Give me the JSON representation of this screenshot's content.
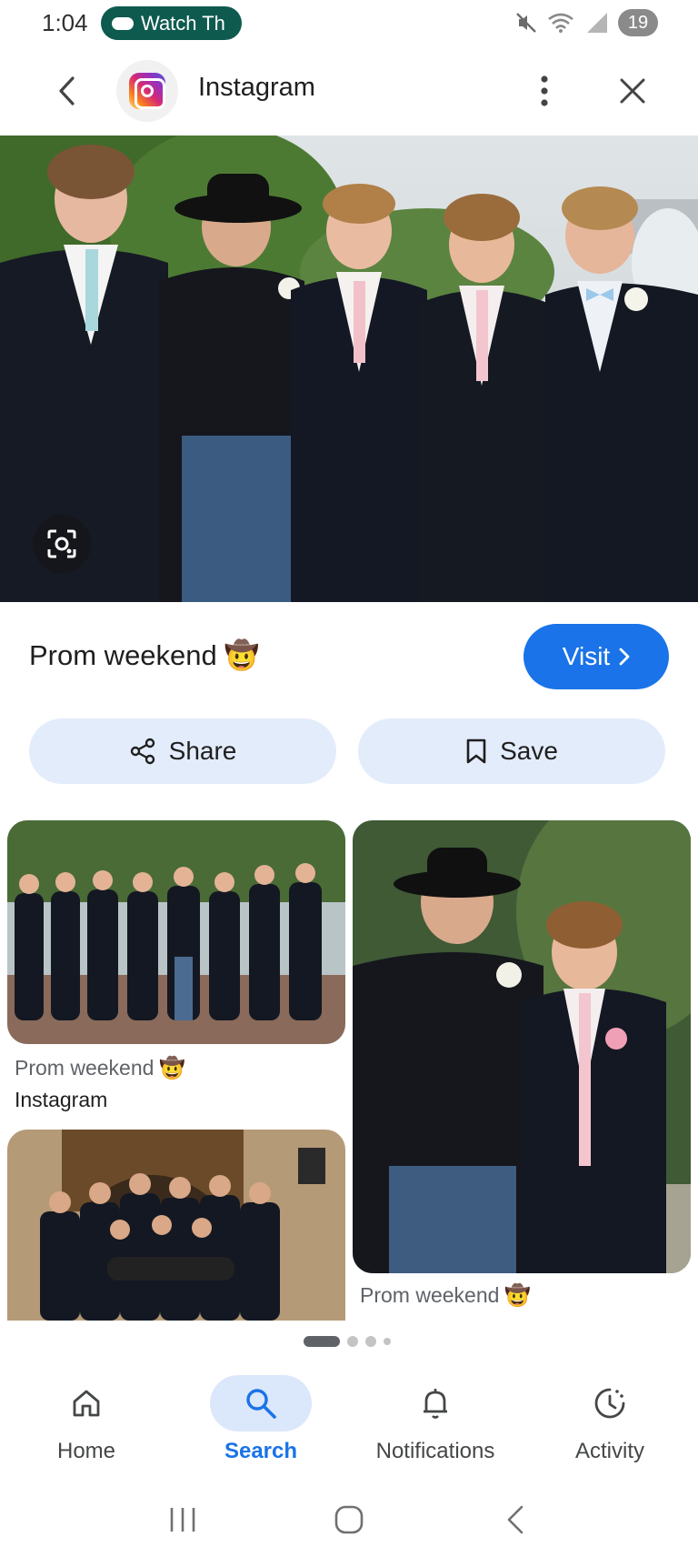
{
  "status_bar": {
    "time": "1:04",
    "pill_text": "Watch Th",
    "battery": "19"
  },
  "header": {
    "title": "Instagram"
  },
  "post": {
    "title": "Prom weekend",
    "title_emoji": "🤠",
    "visit_label": "Visit",
    "share_label": "Share",
    "save_label": "Save"
  },
  "related": [
    {
      "caption": "Prom weekend",
      "emoji": "🤠",
      "source": "Instagram"
    },
    {
      "caption": "Prom weekend",
      "emoji": "🤠",
      "source": ""
    },
    {
      "caption": "",
      "emoji": "",
      "source": ""
    }
  ],
  "bottom_nav": [
    {
      "label": "Home",
      "icon": "home-icon",
      "active": false
    },
    {
      "label": "Search",
      "icon": "search-icon",
      "active": true
    },
    {
      "label": "Notifications",
      "icon": "bell-icon",
      "active": false
    },
    {
      "label": "Activity",
      "icon": "activity-icon",
      "active": false
    }
  ],
  "colors": {
    "accent": "#1a73e8",
    "action_button_bg": "#e3ecfb",
    "nav_active_bg": "#dbe7fb",
    "status_pill": "#0e5a4f"
  }
}
